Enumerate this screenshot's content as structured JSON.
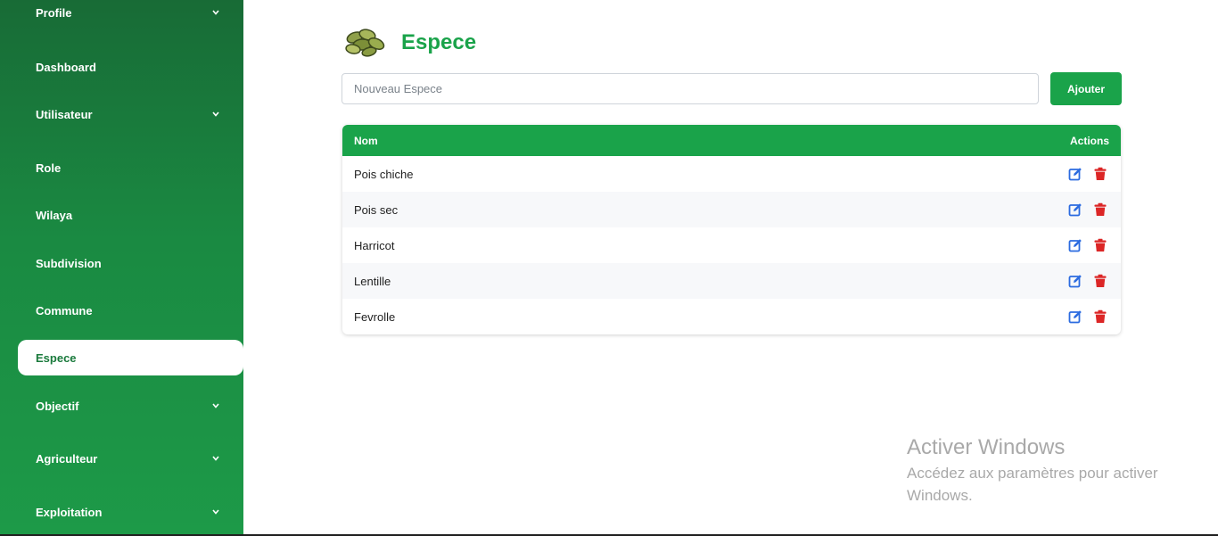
{
  "sidebar": {
    "items": [
      {
        "label": "Profile",
        "has_children": true
      },
      {
        "label": "Dashboard",
        "has_children": false
      },
      {
        "label": "Utilisateur",
        "has_children": true
      },
      {
        "label": "Role",
        "has_children": false
      },
      {
        "label": "Wilaya",
        "has_children": false
      },
      {
        "label": "Subdivision",
        "has_children": false
      },
      {
        "label": "Commune",
        "has_children": false
      },
      {
        "label": "Espece",
        "has_children": false,
        "active": true
      },
      {
        "label": "Objectif",
        "has_children": true
      },
      {
        "label": "Agriculteur",
        "has_children": true
      },
      {
        "label": "Exploitation",
        "has_children": true
      }
    ]
  },
  "page": {
    "title": "Espece",
    "logo_icon": "seeds-icon"
  },
  "form": {
    "placeholder": "Nouveau Espece",
    "value": "",
    "add_label": "Ajouter"
  },
  "table": {
    "headers": {
      "name": "Nom",
      "actions": "Actions"
    },
    "rows": [
      {
        "name": "Pois chiche"
      },
      {
        "name": "Pois sec"
      },
      {
        "name": "Harricot"
      },
      {
        "name": "Lentille"
      },
      {
        "name": "Fevrolle"
      }
    ]
  },
  "watermark": {
    "title": "Activer Windows",
    "subtitle": "Accédez aux paramètres pour activer Windows."
  },
  "colors": {
    "accent": "#1aa34a",
    "sidebar_dark": "#186b36",
    "edit_icon": "#2b6be0",
    "delete_icon": "#dc2626"
  }
}
